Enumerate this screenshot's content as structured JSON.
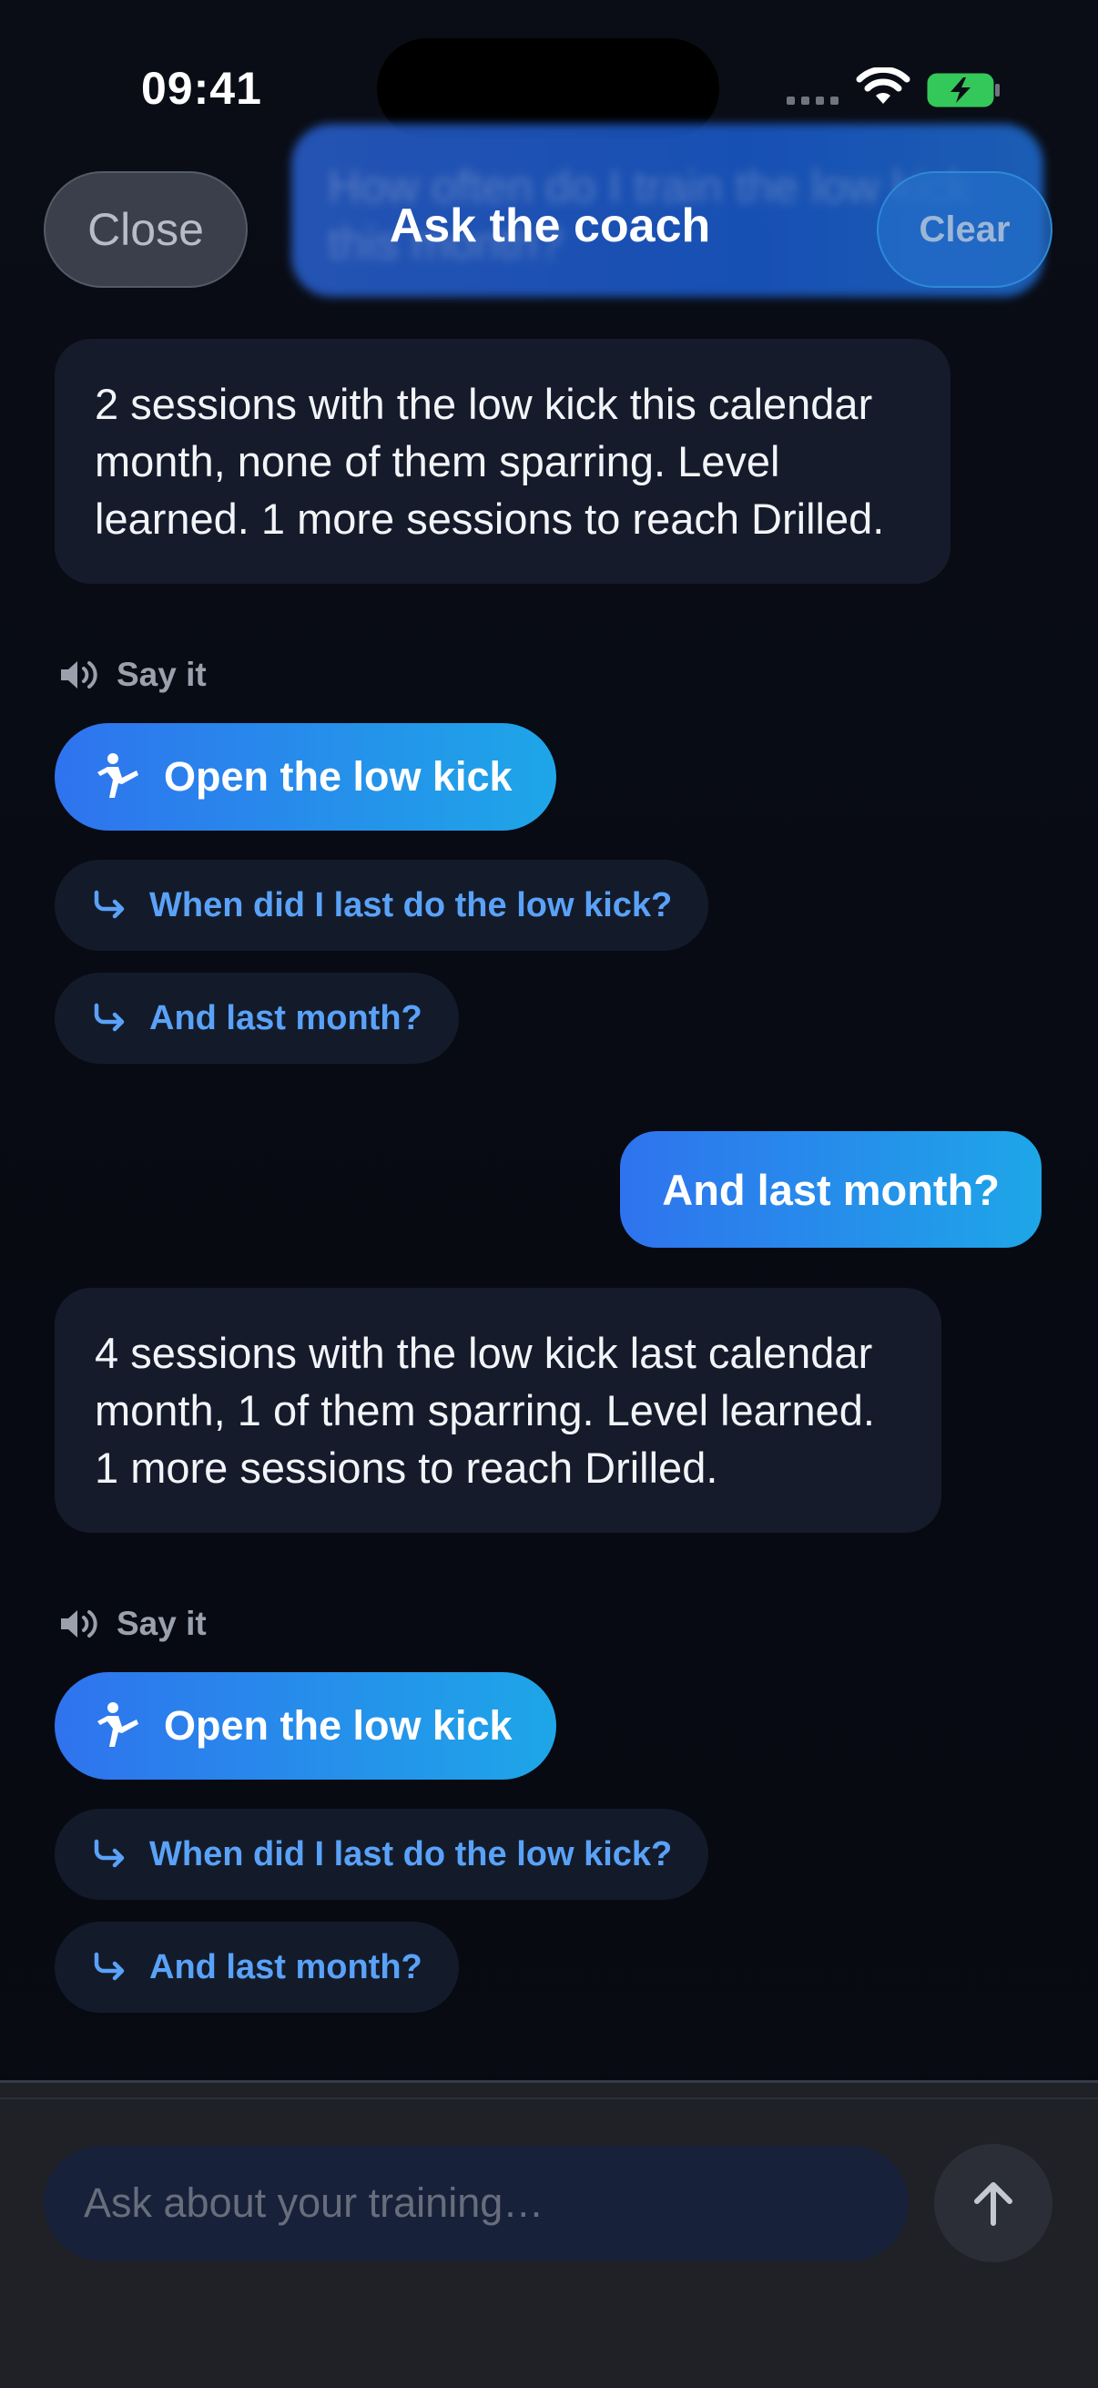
{
  "status": {
    "time": "09:41"
  },
  "nav": {
    "close_label": "Close",
    "title": "Ask the coach",
    "clear_label": "Clear",
    "ghost_text": "How often do I train the low kick this month?"
  },
  "messages": [
    {
      "role": "assistant",
      "text": "2 sessions with the low kick this calendar month, none of them sparring. Level learned. 1 more sessions to reach Drilled.",
      "say_it": "Say it",
      "action": "Open the low kick",
      "suggestions": [
        "When did I last do the low kick?",
        "And last month?"
      ]
    },
    {
      "role": "user",
      "text": "And last month?"
    },
    {
      "role": "assistant",
      "text": "4 sessions with the low kick last calendar month, 1 of them sparring. Level learned. 1 more sessions to reach Drilled.",
      "say_it": "Say it",
      "action": "Open the low kick",
      "suggestions": [
        "When did I last do the low kick?",
        "And last month?"
      ]
    }
  ],
  "composer": {
    "placeholder": "Ask about your training…"
  },
  "icons": {
    "speaker": "speaker-icon",
    "kick": "martial-arts-kick-icon",
    "suggestion_arrow": "turn-right-arrow-icon",
    "send": "arrow-up-icon",
    "wifi": "wifi-icon",
    "battery": "battery-charging-icon"
  },
  "colors": {
    "background": "#070a12",
    "accent_start": "#2f73ee",
    "accent_end": "#1ea6e8",
    "bubble": "#151b2a",
    "suggestion_text": "#5aa2f8",
    "battery": "#34c759"
  }
}
